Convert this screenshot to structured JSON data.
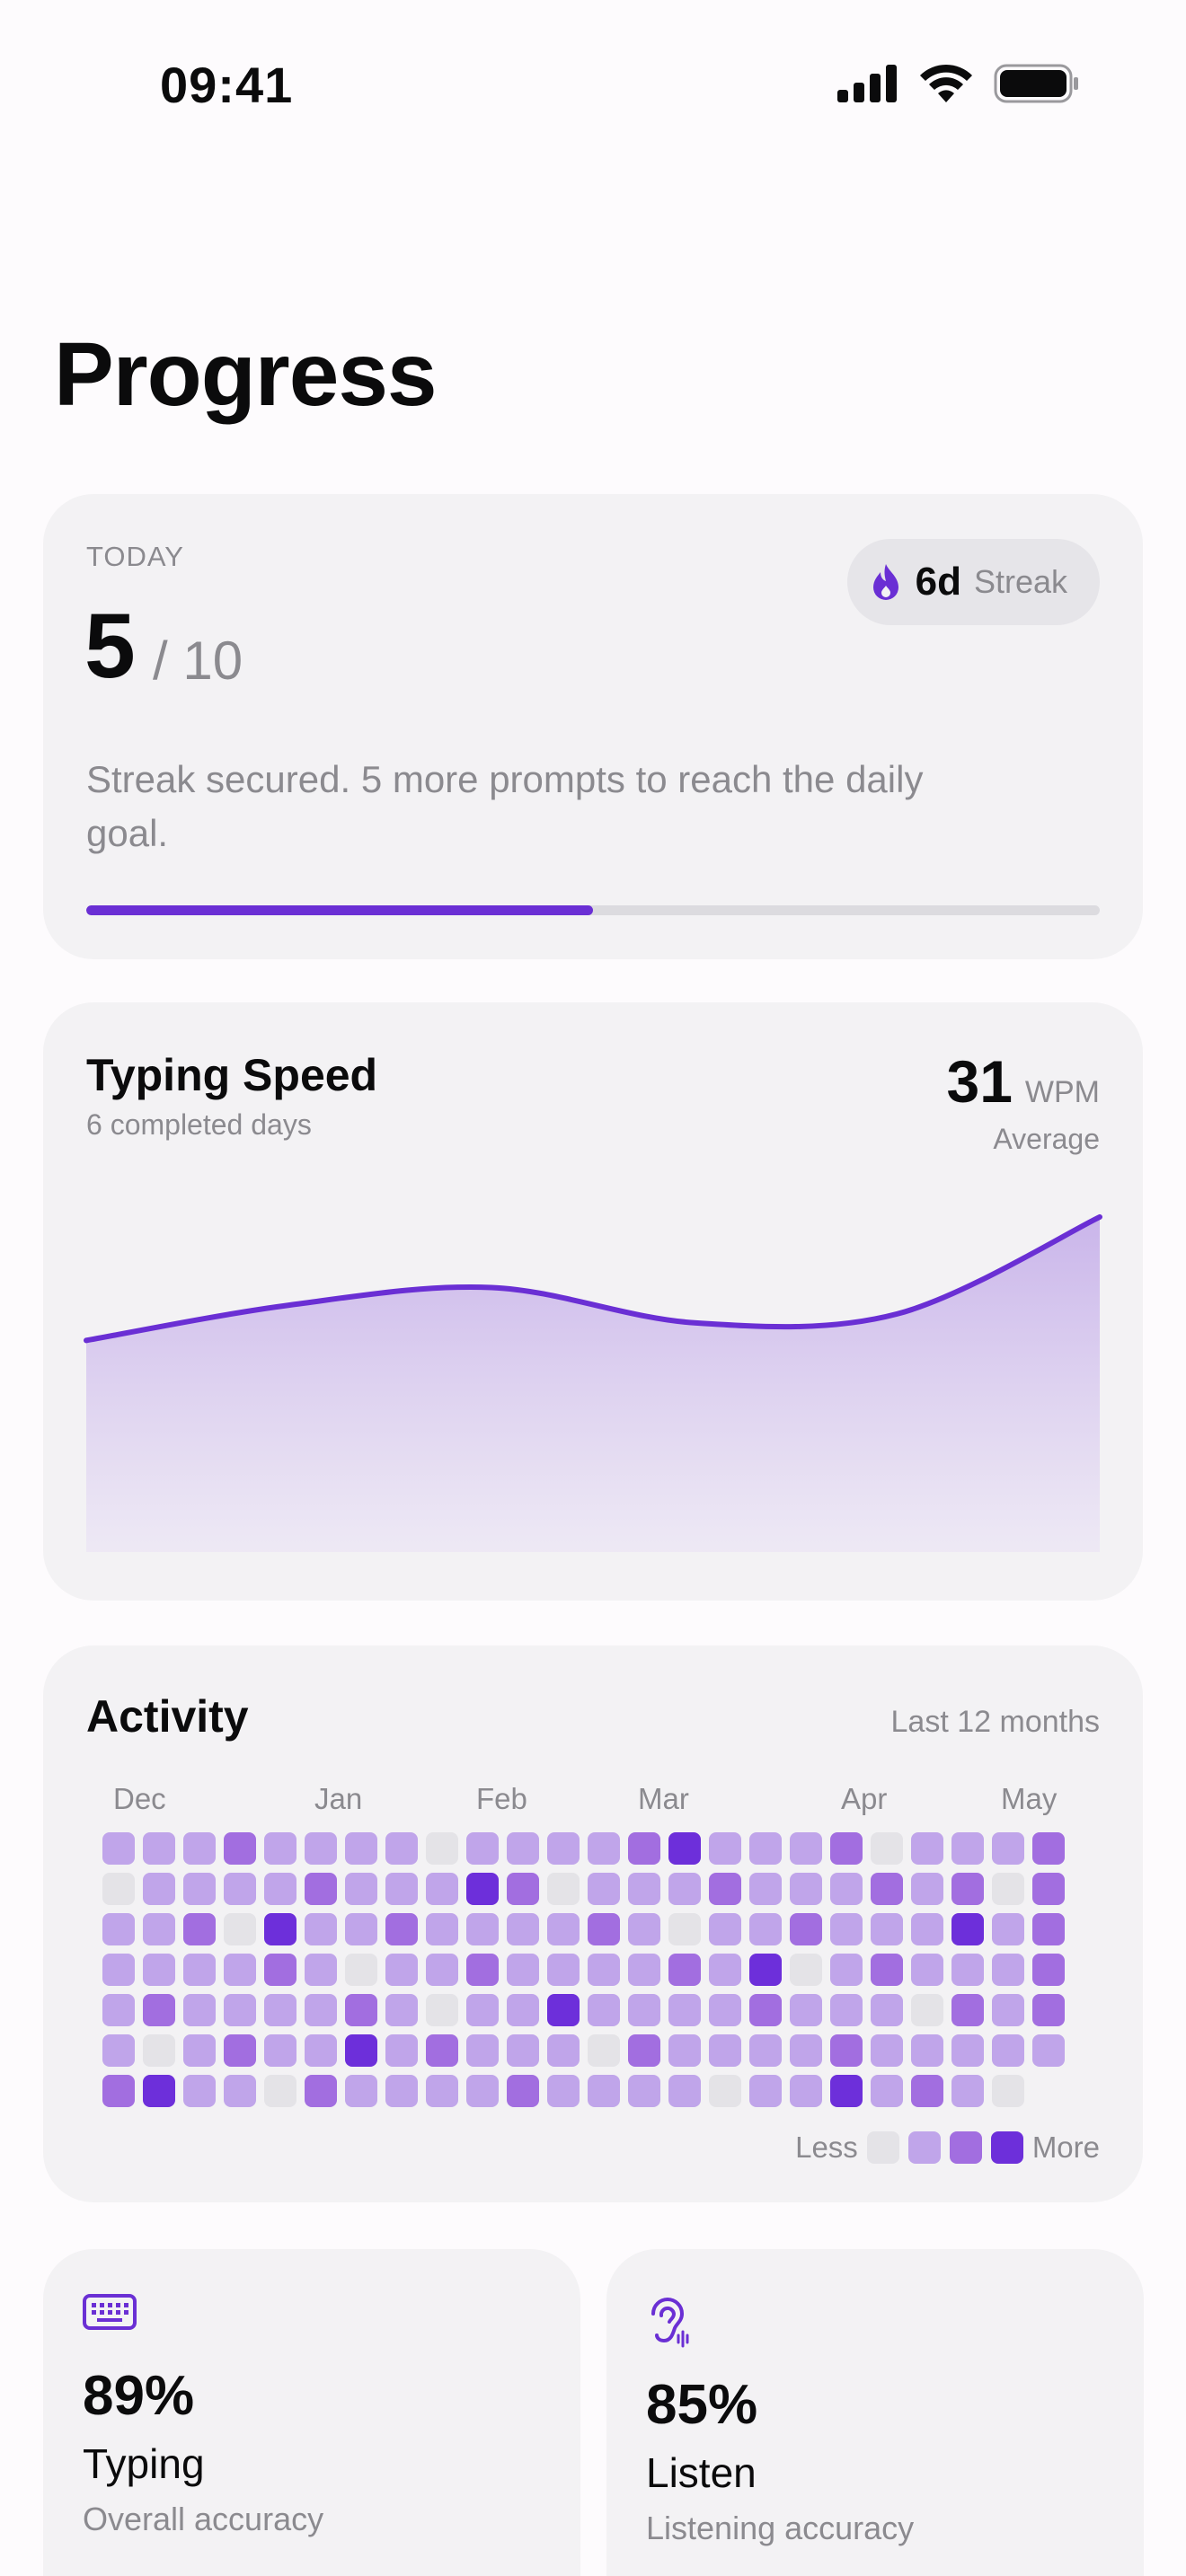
{
  "status_bar": {
    "time": "09:41",
    "icons": [
      "cellular-signal-icon",
      "wifi-icon",
      "battery-icon"
    ]
  },
  "page": {
    "title": "Progress"
  },
  "today": {
    "label": "TODAY",
    "count": "5",
    "goal": "/ 10",
    "progress": 0.5,
    "streak_days": "6d",
    "streak_word": "Streak",
    "message": "Streak secured. 5 more prompts to reach the daily goal."
  },
  "typing_speed": {
    "title": "Typing Speed",
    "subtitle": "6 completed days",
    "value": "31",
    "unit": "WPM",
    "value_caption": "Average"
  },
  "chart_data": {
    "type": "area",
    "x": [
      1,
      2,
      3,
      4,
      5,
      6
    ],
    "values": [
      24,
      26,
      27,
      25,
      25.5,
      31
    ],
    "ylim": [
      12,
      34
    ],
    "title": "",
    "xlabel": "",
    "ylabel": "",
    "grid": false,
    "accent": "#6a2fd4"
  },
  "activity": {
    "title": "Activity",
    "range": "Last 12 months",
    "months": [
      "Dec",
      "Jan",
      "Feb",
      "Mar",
      "Apr",
      "May"
    ],
    "legend_less": "Less",
    "legend_more": "More",
    "level_colors": [
      "#e4e3e7",
      "#c0a5ea",
      "#a26ee0",
      "#6d2fda"
    ],
    "weeks": [
      [
        1,
        0,
        1,
        1,
        1,
        1,
        2
      ],
      [
        1,
        1,
        1,
        1,
        2,
        0,
        3
      ],
      [
        1,
        1,
        2,
        1,
        1,
        1,
        1
      ],
      [
        2,
        1,
        0,
        1,
        1,
        2,
        1
      ],
      [
        1,
        1,
        3,
        2,
        1,
        1,
        0
      ],
      [
        1,
        2,
        1,
        1,
        1,
        1,
        2
      ],
      [
        1,
        1,
        1,
        0,
        2,
        3,
        1
      ],
      [
        1,
        1,
        2,
        1,
        1,
        1,
        1
      ],
      [
        0,
        1,
        1,
        1,
        0,
        2,
        1
      ],
      [
        1,
        3,
        1,
        2,
        1,
        1,
        1
      ],
      [
        1,
        2,
        1,
        1,
        1,
        1,
        2
      ],
      [
        1,
        0,
        1,
        1,
        3,
        1,
        1
      ],
      [
        1,
        1,
        2,
        1,
        1,
        0,
        1
      ],
      [
        2,
        1,
        1,
        1,
        1,
        2,
        1
      ],
      [
        3,
        1,
        0,
        2,
        1,
        1,
        1
      ],
      [
        1,
        2,
        1,
        1,
        1,
        1,
        0
      ],
      [
        1,
        1,
        1,
        3,
        2,
        1,
        1
      ],
      [
        1,
        1,
        2,
        0,
        1,
        1,
        1
      ],
      [
        2,
        1,
        1,
        1,
        1,
        2,
        3
      ],
      [
        0,
        2,
        1,
        2,
        1,
        1,
        1
      ],
      [
        1,
        1,
        1,
        1,
        0,
        1,
        2
      ],
      [
        1,
        2,
        3,
        1,
        2,
        1,
        1
      ],
      [
        1,
        0,
        1,
        1,
        1,
        1,
        0
      ],
      [
        2,
        2,
        2,
        2,
        2,
        1,
        null
      ]
    ]
  },
  "stats": [
    {
      "icon": "keyboard-icon",
      "percent": "89%",
      "name": "Typing",
      "desc": "Overall accuracy"
    },
    {
      "icon": "ear-icon",
      "percent": "85%",
      "name": "Listen",
      "desc": "Listening accuracy"
    }
  ]
}
